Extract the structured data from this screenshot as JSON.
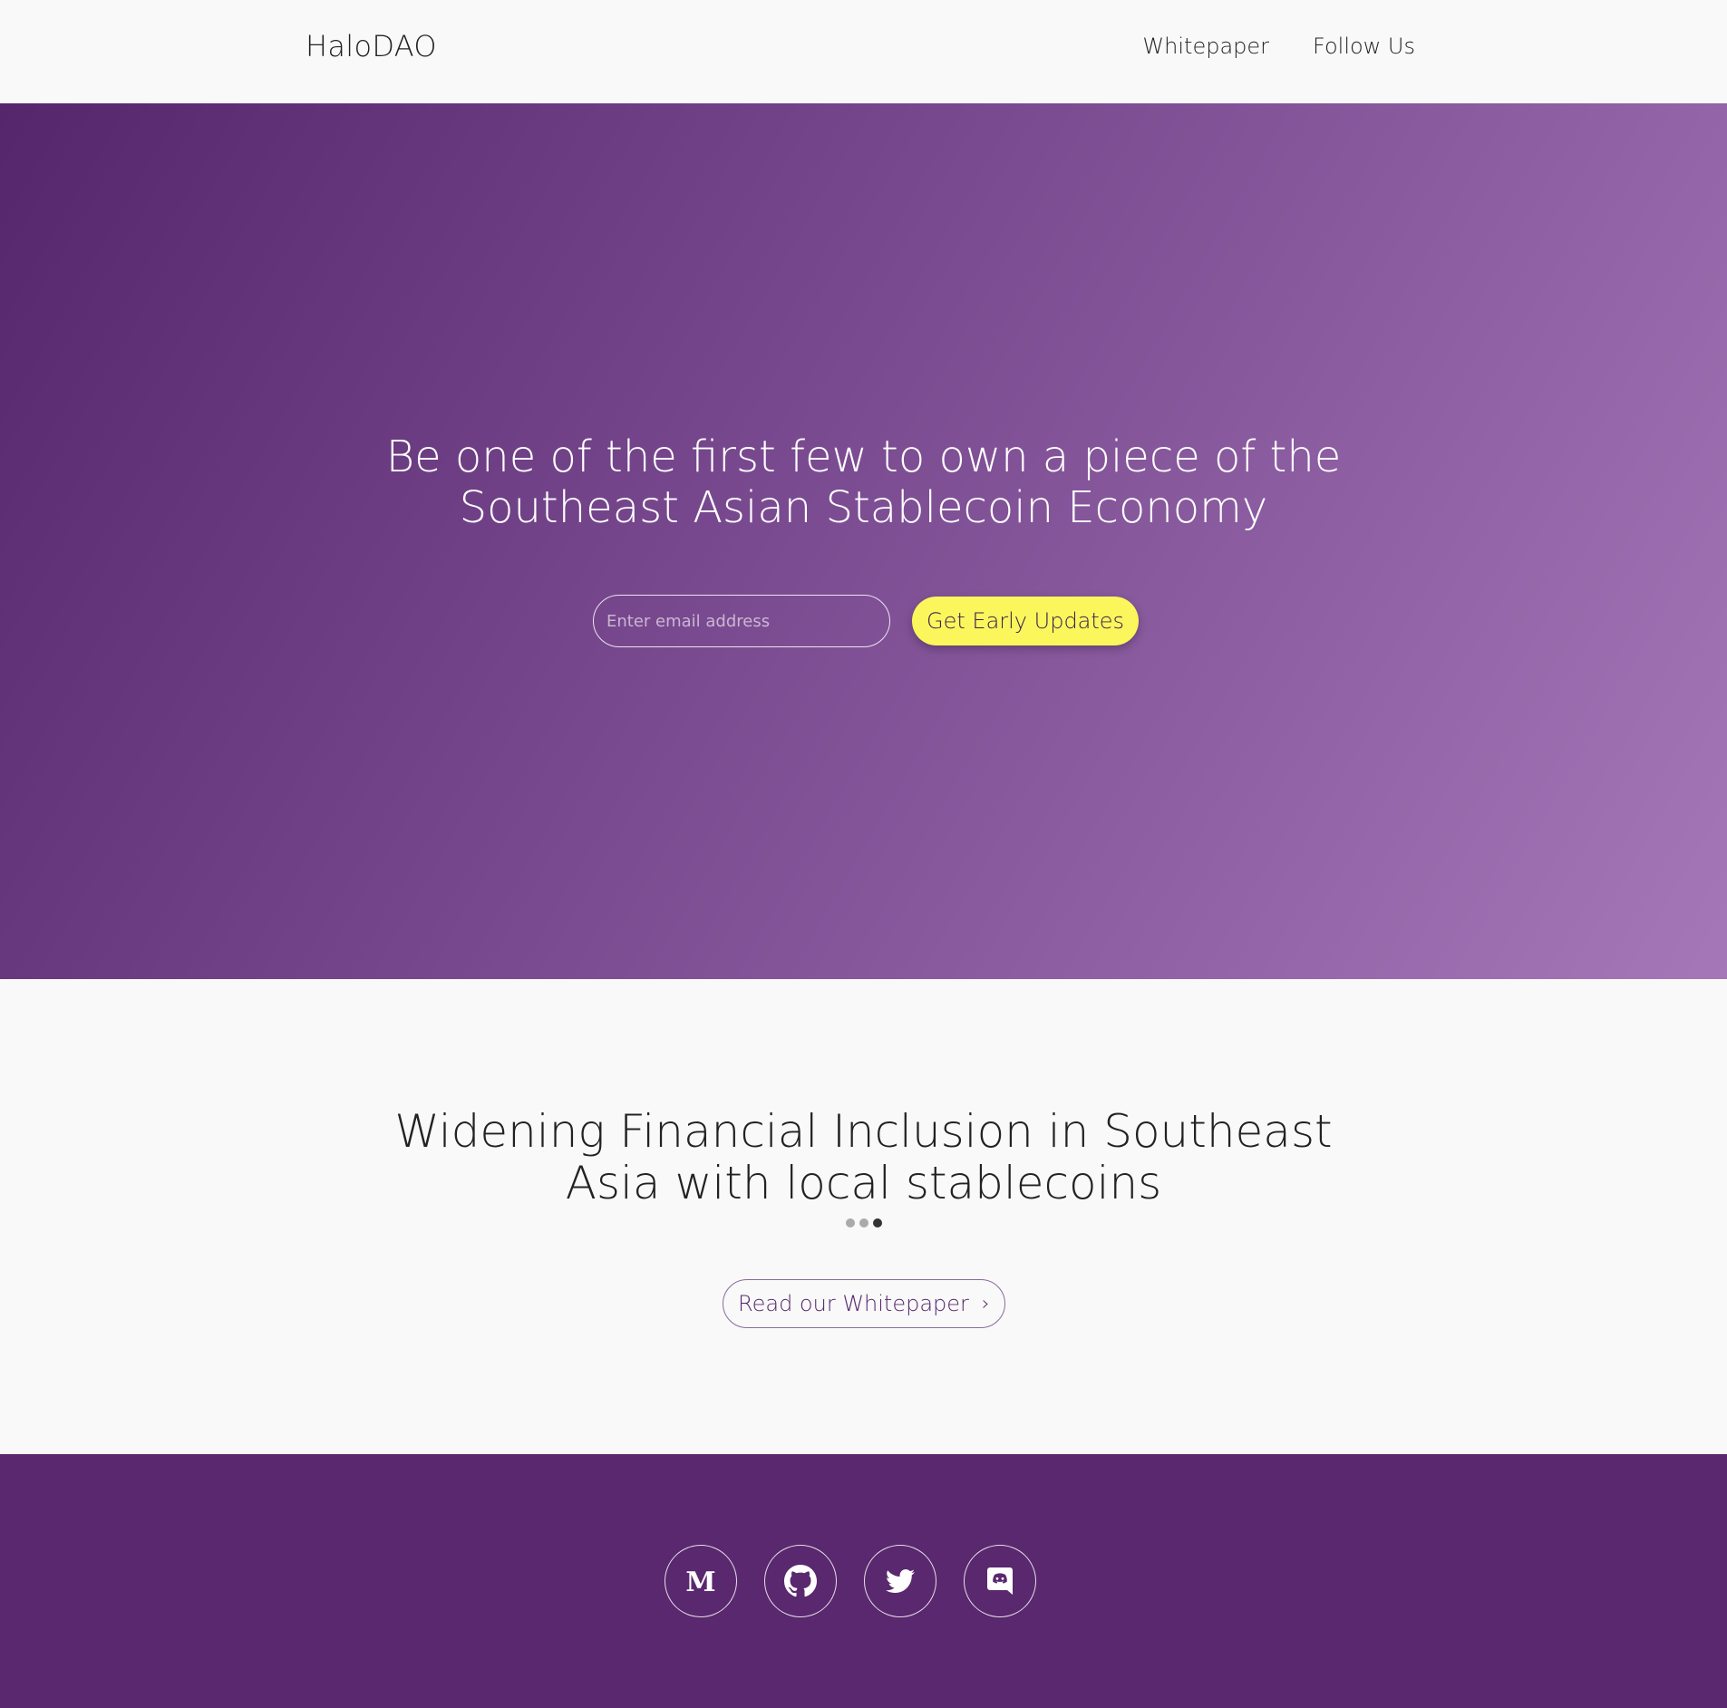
{
  "header": {
    "logo": "HaloDAO",
    "nav": [
      {
        "label": "Whitepaper"
      },
      {
        "label": "Follow Us"
      }
    ]
  },
  "hero": {
    "title_line1": "Be one of the first few to own a piece of the",
    "title_line2": "Southeast Asian Stablecoin Economy",
    "email_placeholder": "Enter email address",
    "cta_label": "Get Early Updates"
  },
  "mission": {
    "title_line1": "Widening Financial Inclusion in Southeast",
    "title_line2": "Asia with local stablecoins",
    "carousel_total": 3,
    "carousel_active": 3,
    "whitepaper_label": "Read our Whitepaper",
    "whitepaper_chevron": "›"
  },
  "footer": {
    "socials": [
      {
        "icon": "medium-icon"
      },
      {
        "icon": "github-icon"
      },
      {
        "icon": "twitter-icon"
      },
      {
        "icon": "discord-icon"
      }
    ]
  },
  "colors": {
    "hero_gradient_start": "#56266c",
    "hero_gradient_end": "#a577b8",
    "cta_background": "#fbf65c",
    "footer_background": "#5a286f",
    "page_background": "#f9f9f9"
  }
}
